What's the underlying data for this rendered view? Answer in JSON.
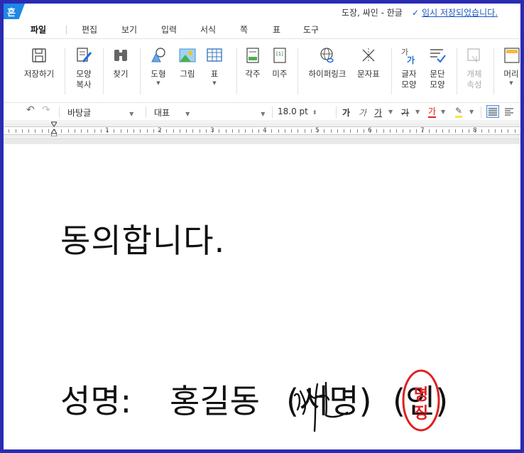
{
  "app": {
    "logo_char": "흔",
    "title": "도장, 싸인 - 한글",
    "save_status": "임시 저장되었습니다."
  },
  "menu": [
    "파일",
    "편집",
    "보기",
    "입력",
    "서식",
    "쪽",
    "표",
    "도구"
  ],
  "ribbon": {
    "save": "저장하기",
    "format_copy_1": "모양",
    "format_copy_2": "복사",
    "find": "찾기",
    "shape": "도형",
    "picture": "그림",
    "table": "표",
    "footnote": "각주",
    "endnote": "미주",
    "hyperlink": "하이퍼링크",
    "symbol": "문자표",
    "char_shape_1": "글자",
    "char_shape_2": "모양",
    "para_shape_1": "문단",
    "para_shape_2": "모양",
    "object_prop_1": "개체",
    "object_prop_2": "속성",
    "header": "머리"
  },
  "format": {
    "font": "바탕글",
    "style": "대표",
    "size": "18.0",
    "unit": "pt",
    "bold": "가",
    "italic": "가",
    "underline": "가",
    "strike": "가",
    "font_color": "가"
  },
  "ruler": {
    "numbers": [
      "1",
      "2",
      "3",
      "4",
      "5",
      "6",
      "7",
      "8"
    ]
  },
  "document": {
    "line1": "동의합니다.",
    "name_label": "성명:",
    "name_value": "홍길동",
    "sign_text": "(서명)",
    "seal_text": "(인)",
    "seal_stamp_1": "명",
    "seal_stamp_2": "징",
    "signature_scribble": "싸인"
  },
  "colors": {
    "frame": "#2b2bb3",
    "accent": "#1e88e5",
    "link": "#1a56c5",
    "seal": "#e02020"
  }
}
